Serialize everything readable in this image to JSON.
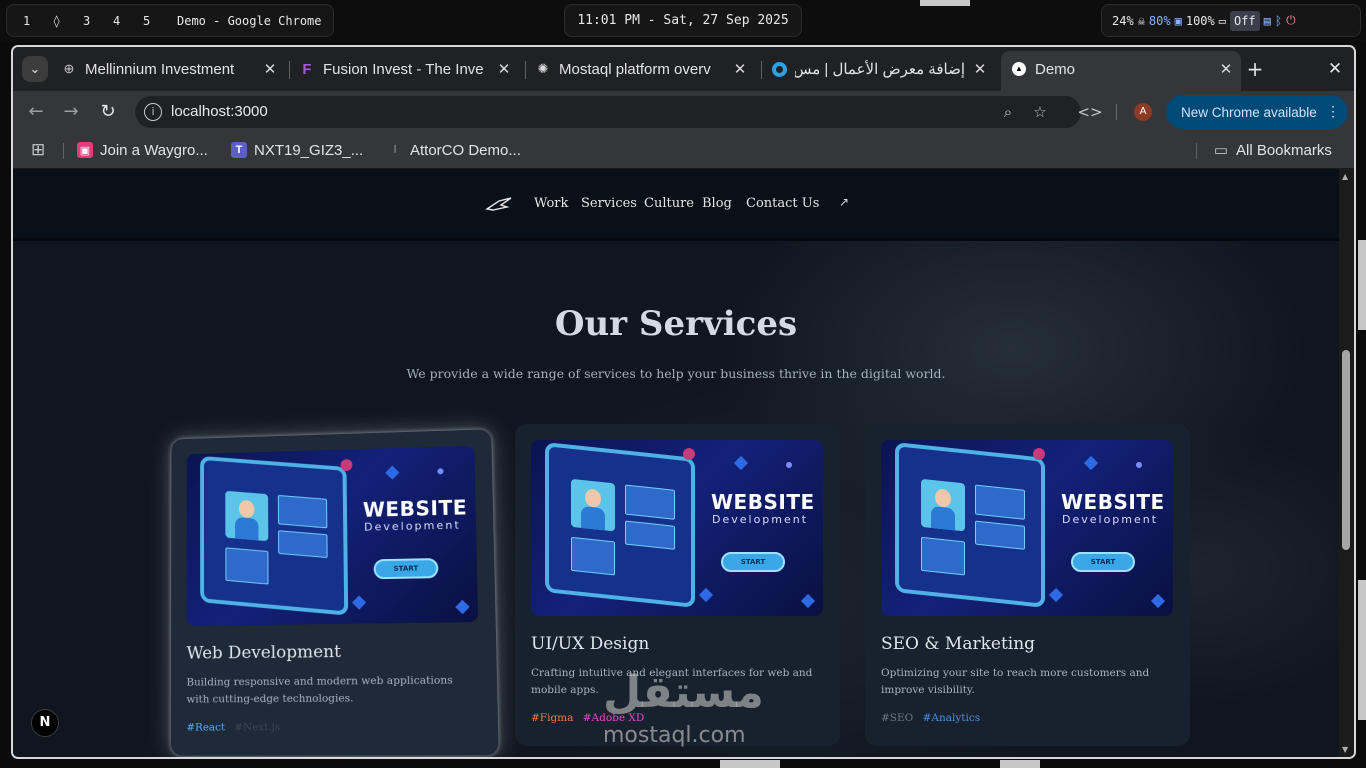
{
  "desktop": {
    "workspaces": [
      "1",
      "",
      "3",
      "4",
      "5"
    ],
    "active_window_title": "Demo - Google Chrome",
    "clock": "11:01 PM - Sat, 27 Sep 2025",
    "status": {
      "cpu": "24%",
      "memory": "80%",
      "disk": "100%",
      "toggle": "Off"
    }
  },
  "browser": {
    "tabs": [
      {
        "title": "Mellinnium Investment",
        "icon": "globe-icon"
      },
      {
        "title": "Fusion Invest - The Inve",
        "icon": "figma-f-icon"
      },
      {
        "title": "Mostaql platform overv",
        "icon": "openai-icon"
      },
      {
        "title": "إضافة معرض الأعمال | مس",
        "icon": "mostaql-icon"
      },
      {
        "title": "Demo",
        "icon": "nextjs-icon",
        "active": true
      }
    ],
    "url": "localhost:3000",
    "profile_initial": "A",
    "update_button": "New Chrome available",
    "bookmarks": [
      {
        "title": "Join a Waygro...",
        "icon": "waygro-icon",
        "color": "#e53b7b"
      },
      {
        "title": "NXT19_GIZ3_...",
        "icon": "teams-icon",
        "color": "#5b5fc7"
      },
      {
        "title": "AttorCO Demo...",
        "icon": "attorco-icon",
        "color": "#9e9e9e"
      }
    ],
    "all_bookmarks": "All Bookmarks"
  },
  "site": {
    "nav": [
      "Work",
      "Services",
      "Culture",
      "Blog",
      "Contact Us"
    ],
    "nav_arrow": "↗",
    "section_title": "Our Services",
    "section_subtitle": "We provide a wide range of services to help your business thrive in the digital world.",
    "illustration_title": "WEBSITE",
    "illustration_subtitle": "Development",
    "illustration_button": "START",
    "cards": [
      {
        "title": "Web Development",
        "description": "Building responsive and modern web applications with cutting-edge technologies.",
        "tags": [
          {
            "label": "#React",
            "color": "#61a8ff"
          },
          {
            "label": "#Next.js",
            "color": "#3a4654"
          }
        ]
      },
      {
        "title": "UI/UX Design",
        "description": "Crafting intuitive and elegant interfaces for web and mobile apps.",
        "tags": [
          {
            "label": "#Figma",
            "color": "#f27a4a"
          },
          {
            "label": "#Adobe XD",
            "color": "#e64ad0"
          }
        ]
      },
      {
        "title": "SEO & Marketing",
        "description": "Optimizing your site to reach more customers and improve visibility.",
        "tags": [
          {
            "label": "#SEO",
            "color": "#6b7784"
          },
          {
            "label": "#Analytics",
            "color": "#4e8fe0"
          }
        ]
      }
    ],
    "next_badge": "N"
  },
  "watermark": {
    "arabic": "مستقل",
    "latin": "mostaql.com"
  }
}
